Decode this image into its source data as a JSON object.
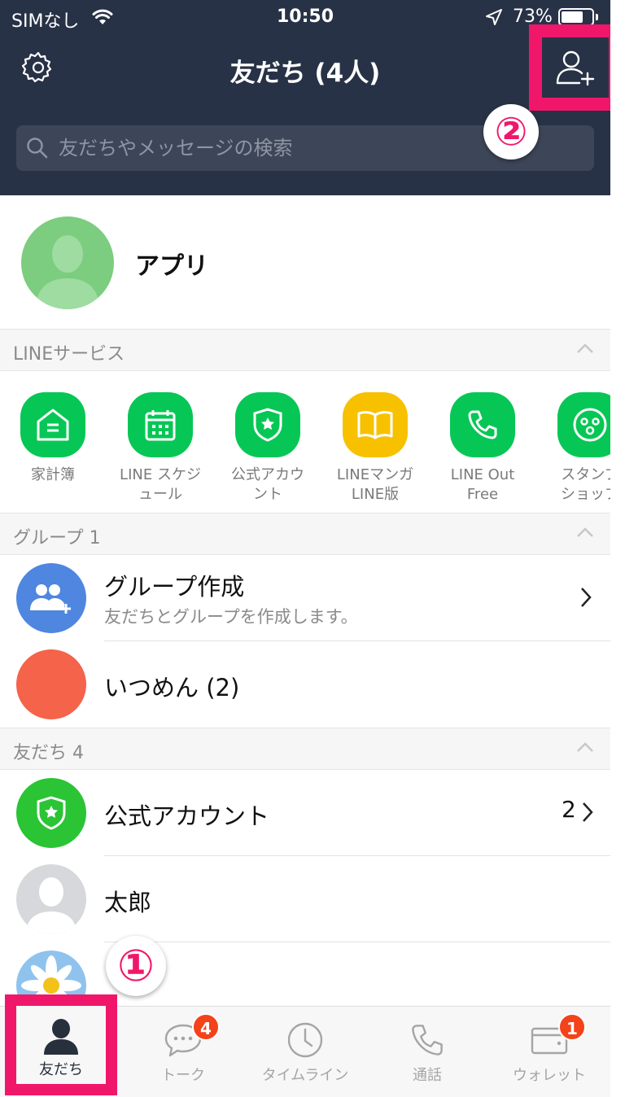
{
  "status_bar": {
    "carrier": "SIMなし",
    "time": "10:50",
    "battery": "73%",
    "icons": [
      "wifi-icon",
      "location-arrow-icon",
      "battery-icon"
    ]
  },
  "header": {
    "title": "友だち (4人)",
    "search_placeholder": "友だちやメッセージの検索",
    "settings_icon": "gear-icon",
    "add_friend_icon": "add-friend-icon"
  },
  "annotations": {
    "marker_1": "①",
    "marker_2": "②",
    "highlight_color": "#f0176a"
  },
  "profile": {
    "name": "アプリ"
  },
  "sections": {
    "services": "LINEサービス",
    "groups": "グループ 1",
    "friends": "友だち 4"
  },
  "services": [
    {
      "label": "家計簿",
      "icon": "home-ledger-icon",
      "color": "#06c755"
    },
    {
      "label": "LINE スケジ\nュール",
      "icon": "calendar-icon",
      "color": "#06c755"
    },
    {
      "label": "公式アカウ\nント",
      "icon": "shield-star-icon",
      "color": "#06c755"
    },
    {
      "label": "LINEマンガ\nLINE版",
      "icon": "book-icon",
      "color": "#f7c100"
    },
    {
      "label": "LINE Out\nFree",
      "icon": "phone-icon",
      "color": "#06c755"
    },
    {
      "label": "スタンプ\nショップ",
      "icon": "sticker-face-icon",
      "color": "#06c755"
    }
  ],
  "groups": {
    "create": {
      "name": "グループ作成",
      "sub": "友だちとグループを作成します。"
    },
    "items": [
      {
        "name": "いつめん (2)"
      }
    ]
  },
  "friends": {
    "official": {
      "name": "公式アカウント",
      "count": "2"
    },
    "items": [
      {
        "name": "太郎"
      }
    ]
  },
  "tabs": [
    {
      "label": "友だち",
      "icon": "person-icon",
      "badge": ""
    },
    {
      "label": "トーク",
      "icon": "chat-bubble-icon",
      "badge": "4"
    },
    {
      "label": "タイムライン",
      "icon": "clock-icon",
      "badge": ""
    },
    {
      "label": "通話",
      "icon": "phone-icon",
      "badge": ""
    },
    {
      "label": "ウォレット",
      "icon": "wallet-icon",
      "badge": "1"
    }
  ],
  "colors": {
    "header_bg": "#283246",
    "line_green": "#06c755",
    "badge_red": "#f4421a",
    "group_blue": "#4f86e0",
    "group_coral": "#f5634a"
  }
}
